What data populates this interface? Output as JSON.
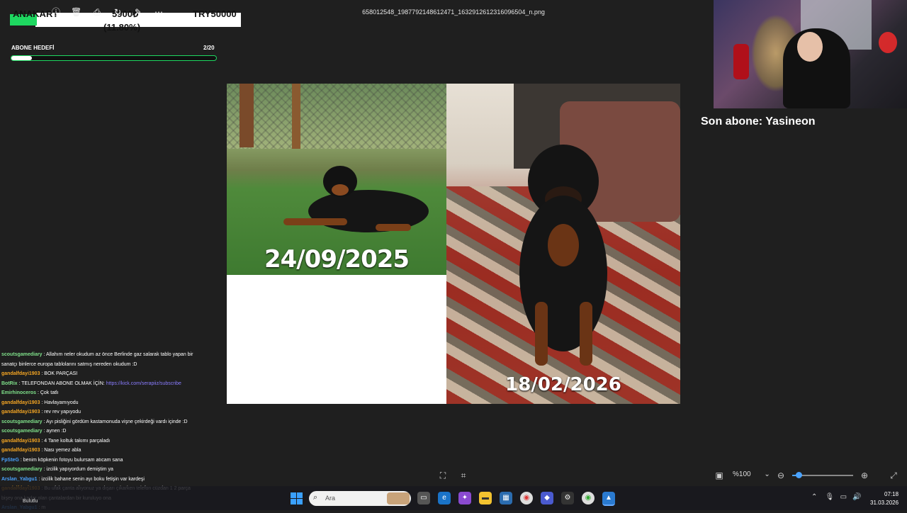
{
  "overlay": {
    "card_label": "ANAKART",
    "amount": "5900₺",
    "percent": "(11.80%)",
    "goal": "TRY50000"
  },
  "viewer": {
    "filename": "658012548_1987792148612471_1632912612316096504_n.png",
    "date_left": "24/09/2025",
    "date_right": "18/02/2026",
    "zoom": "%100",
    "zoom_level": 0.1
  },
  "sub_goal": {
    "label": "ABONE HEDEFİ",
    "count": "2/20",
    "progress": 0.1
  },
  "last_sub": "Son abone: Yasineon",
  "chat": [
    {
      "user": "scoutsgamediary",
      "color": "#7fe08a",
      "text": " : Allahım neler okudum az önce Berlinde gaz salarak tablo yapan bir"
    },
    {
      "user": "",
      "color": "#ffffff",
      "text": "sanatçı binlerce europa tablolarını satmış nereden okudum :D"
    },
    {
      "user": "gandalfdayi1903",
      "color": "#f5a623",
      "text": " : BOK PARÇASI"
    },
    {
      "user": "BotRix",
      "color": "#7fe08a",
      "text": " : TELEFONDAN ABONE OLMAK İÇİN: ",
      "link": "https://kick.com/serapiiz/subscribe"
    },
    {
      "user": "Emirhinoceros",
      "color": "#7fe08a",
      "text": " : Çok tatlı"
    },
    {
      "user": "gandalfdayi1903",
      "color": "#f5a623",
      "text": " : Havlayamıyodu"
    },
    {
      "user": "gandalfdayi1903",
      "color": "#f5a623",
      "text": " : rev rev yapıyodu"
    },
    {
      "user": "scoutsgamediary",
      "color": "#7fe08a",
      "text": " : Ayı pisliğini gördüm kastamonuda vişne çekirdeği vardı içinde :D"
    },
    {
      "user": "scoutsgamediary",
      "color": "#7fe08a",
      "text": " : aynen :D"
    },
    {
      "user": "gandalfdayi1903",
      "color": "#f5a623",
      "text": " : 4 Tane koltuk takımı parçaladı"
    },
    {
      "user": "gandalfdayi1903",
      "color": "#f5a623",
      "text": " : Nası yemez abla"
    },
    {
      "user": "FpSteG",
      "color": "#4aa3ff",
      "text": " : benim köpkenin fotoyu bulursam atıcam sana"
    },
    {
      "user": "scoutsgamediary",
      "color": "#7fe08a",
      "text": " : izcilik yapıyordum demiştim ya"
    },
    {
      "user": "Arslan_Yabgu1",
      "color": "#4aa3ff",
      "text": " : izcilik bahane senin ayı boku fetişin var kardeşi"
    },
    {
      "user": "gandalfdayi1903",
      "color": "#f5a623",
      "text": " : Bu ufak çanta alıyonuz ya dışarı çıkarken telefon cüzdan 1 2 parça"
    },
    {
      "user": "",
      "color": "#ffffff",
      "text": "bişey ona kadar olan çantalardan bir kuruluyo ona"
    },
    {
      "user": "Arslan_Yabgu1",
      "color": "#4aa3ff",
      "text": " : m"
    }
  ],
  "taskbar": {
    "search_placeholder": "Ara",
    "weather": "Bulutlu",
    "time": "07:18",
    "date": "31.03.2026"
  }
}
